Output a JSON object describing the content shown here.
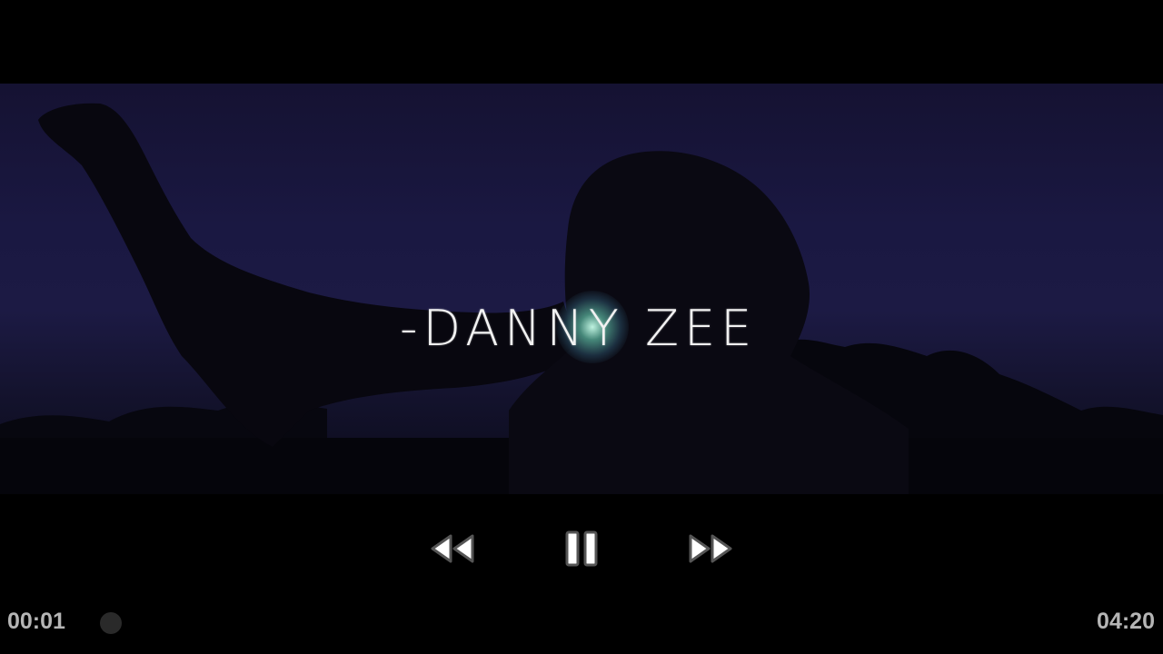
{
  "video": {
    "title_overlay": "-DANNY ZEE"
  },
  "controls": {
    "rewind_icon": "rewind-icon",
    "pause_icon": "pause-icon",
    "forward_icon": "fast-forward-icon"
  },
  "playback": {
    "current_time": "00:01",
    "total_time": "04:20",
    "progress": 0.004
  }
}
